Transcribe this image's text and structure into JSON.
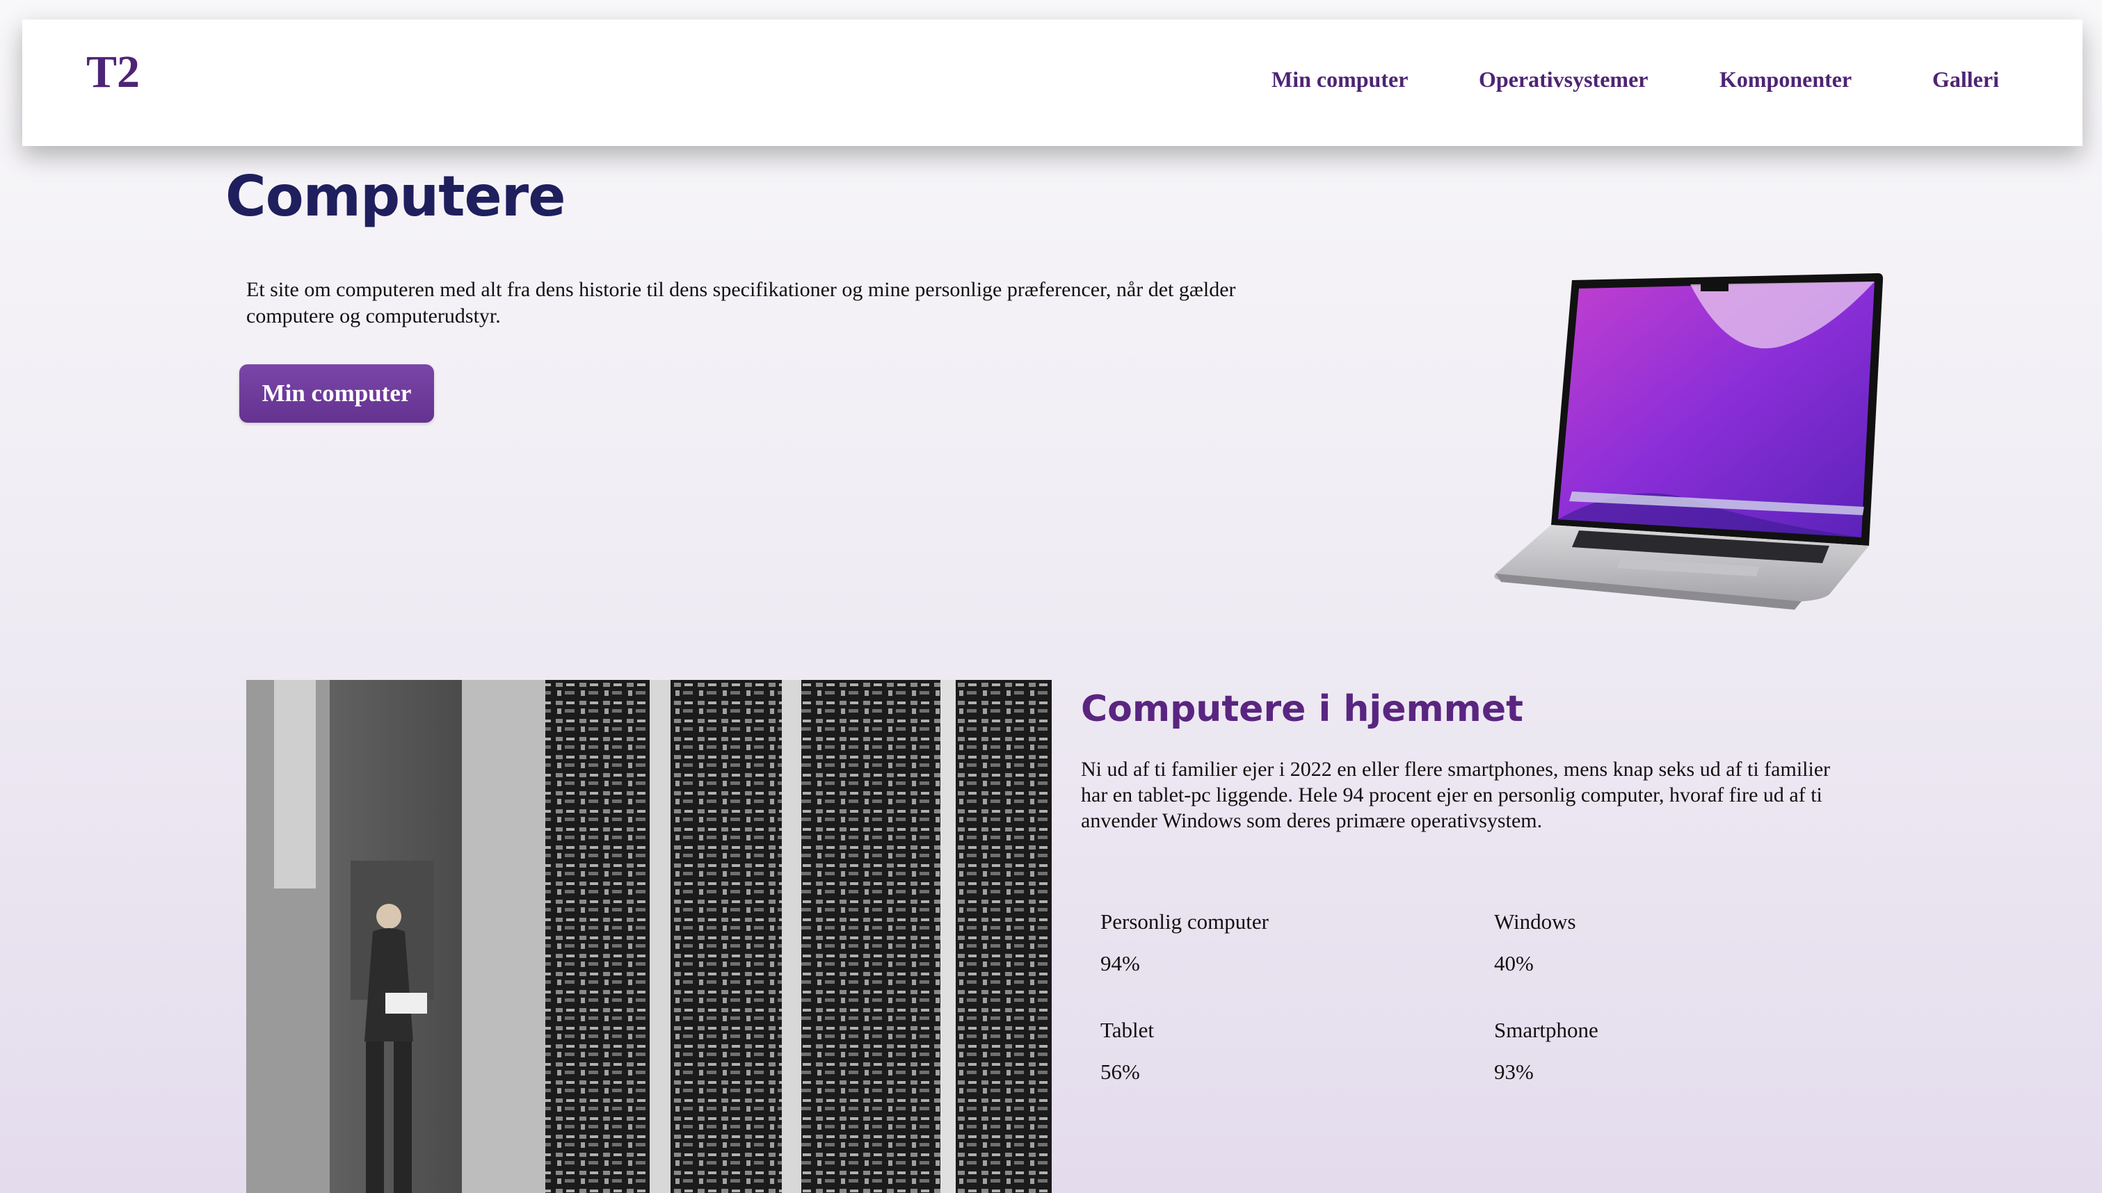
{
  "header": {
    "logo": "T2",
    "nav": [
      "Min computer",
      "Operativsystemer",
      "Komponenter",
      "Galleri"
    ]
  },
  "hero": {
    "title": "Computere",
    "intro": "Et site om computeren med alt fra dens historie til dens specifikationer og mine personlige præferencer, når det gælder computere og computerudstyr.",
    "button_label": "Min computer"
  },
  "section": {
    "heading": "Computere i hjemmet",
    "text": "Ni ud af ti familier ejer i 2022 en eller flere smartphones, mens knap seks ud af ti familier har en tablet-pc liggende. Hele 94 procent ejer en personlig computer, hvoraf fire ud af ti anvender Windows som deres primære operativsystem.",
    "stats": [
      {
        "label": "Personlig computer",
        "value": "94%"
      },
      {
        "label": "Windows",
        "value": "40%"
      },
      {
        "label": "Tablet",
        "value": "56%"
      },
      {
        "label": "Smartphone",
        "value": "93%"
      }
    ]
  },
  "colors": {
    "brand": "#4e2475",
    "title": "#1f1f5e",
    "button": "#6e3a9c",
    "heading": "#5a2580"
  }
}
